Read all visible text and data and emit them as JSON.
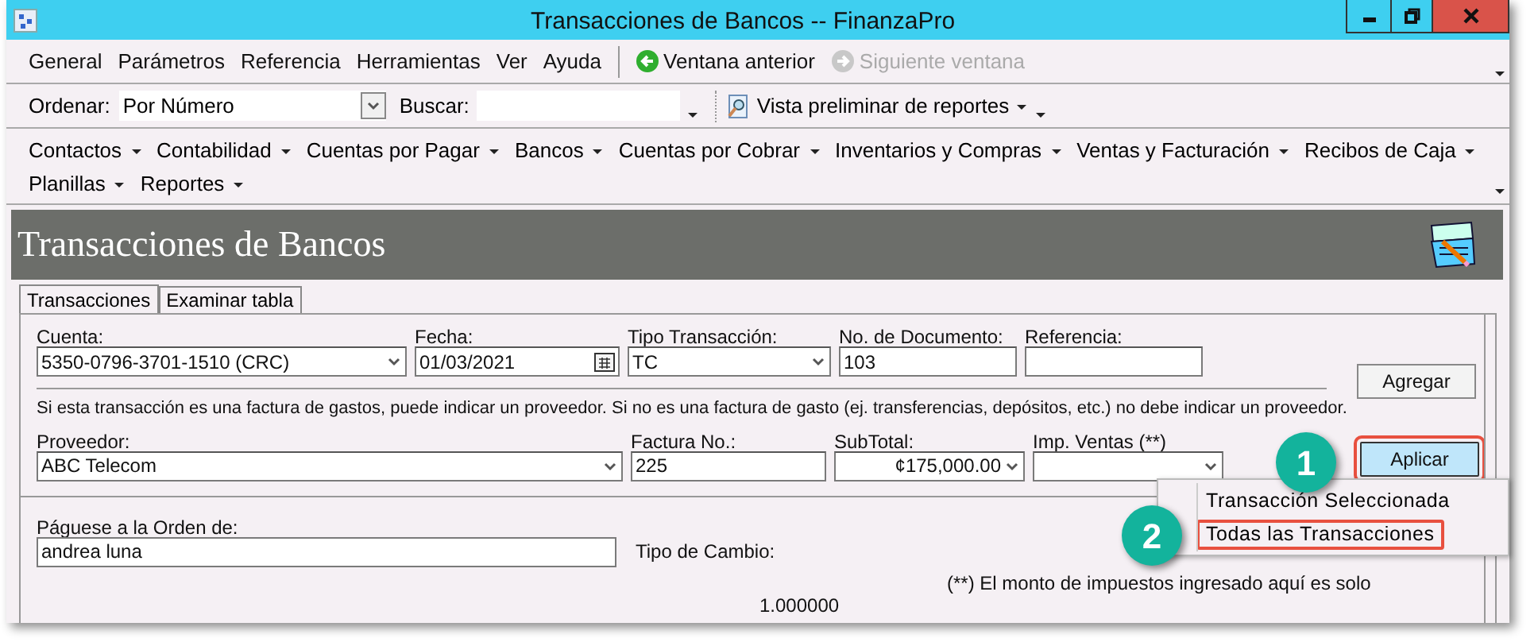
{
  "window": {
    "title": "Transacciones de Bancos -- FinanzaPro"
  },
  "menu_bar": {
    "items": [
      "General",
      "Parámetros",
      "Referencia",
      "Herramientas",
      "Ver",
      "Ayuda"
    ],
    "nav": [
      {
        "label": "Ventana anterior",
        "disabled": false
      },
      {
        "label": "Siguiente ventana",
        "disabled": true
      }
    ]
  },
  "toolbar": {
    "sort_label": "Ordenar:",
    "sort_value": "Por Número",
    "search_label": "Buscar:",
    "preview": "Vista preliminar de reportes"
  },
  "modules": [
    "Contactos",
    "Contabilidad",
    "Cuentas por Pagar",
    "Bancos",
    "Cuentas por Cobrar",
    "Inventarios y Compras",
    "Ventas y Facturación",
    "Recibos de Caja",
    "Planillas",
    "Reportes"
  ],
  "header": {
    "title": "Transacciones de Bancos"
  },
  "tabs": [
    {
      "label": "Transacciones",
      "selected": true
    },
    {
      "label": "Examinar tabla",
      "selected": false
    }
  ],
  "row_1": [
    {
      "label": "Cuenta:",
      "value": "5350-0796-3701-1510 (CRC)",
      "kind": "combo"
    },
    {
      "label": "Fecha:",
      "value": "01/03/2021",
      "kind": "date"
    },
    {
      "label": "Tipo Transacción:",
      "value": "TC",
      "kind": "combo"
    },
    {
      "label": "No. de Documento:",
      "value": "103",
      "kind": "text"
    },
    {
      "label": "Referencia:",
      "kind": "text"
    }
  ],
  "note": "Si esta transacción es una factura de gastos, puede indicar un proveedor. Si no es una factura de gasto (ej. transferencias, depósitos, etc.) no debe indicar un proveedor.",
  "row_2": [
    {
      "label": "Proveedor:",
      "value": "ABC Telecom",
      "kind": "combo"
    },
    {
      "label": "Factura No.:",
      "value": "225",
      "kind": "text"
    },
    {
      "label": "SubTotal:",
      "value": "¢175,000.00",
      "kind": "amount"
    },
    {
      "label": "Imp. Ventas (**)",
      "kind": "amount"
    }
  ],
  "payee": {
    "label": "Páguese a la Orden de:",
    "value": "andrea luna"
  },
  "exchange": {
    "label": "Tipo de Cambio:",
    "value": "1.000000"
  },
  "tax_note": "(**) El monto de impuestos ingresado aquí es solo",
  "buttons": [
    {
      "label": "Agregar",
      "highlighted": false
    },
    {
      "label": "Aplicar",
      "highlighted": true
    }
  ],
  "popup_menu": [
    {
      "label": "Transacción Seleccionada",
      "highlighted": false
    },
    {
      "label": "Todas las Transacciones",
      "highlighted": true
    }
  ],
  "callouts": [
    "1",
    "2"
  ]
}
